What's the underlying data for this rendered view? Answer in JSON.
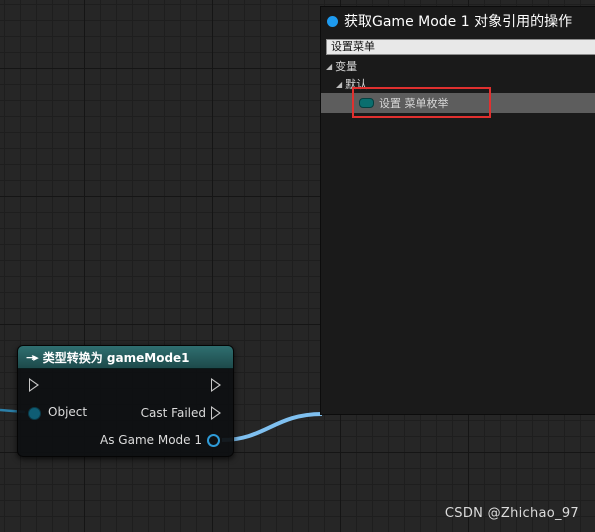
{
  "node": {
    "title": "类型转换为 gameMode1",
    "icon": "cast-arrows-icon",
    "pins": {
      "object": "Object",
      "cast_failed": "Cast Failed",
      "as_game_mode": "As Game Mode 1"
    },
    "header_color": "#2f6f70"
  },
  "panel": {
    "title": "获取Game Mode 1 对象引用的操作",
    "search_value": "设置菜单",
    "tree": {
      "category": "变量",
      "subcategory": "默认",
      "item": "设置 菜单枚举"
    },
    "accent_color": "#1e9bf0"
  },
  "highlight_color": "#e0302f",
  "wire_color": "#7fc0f0",
  "watermark": "CSDN @Zhichao_97"
}
